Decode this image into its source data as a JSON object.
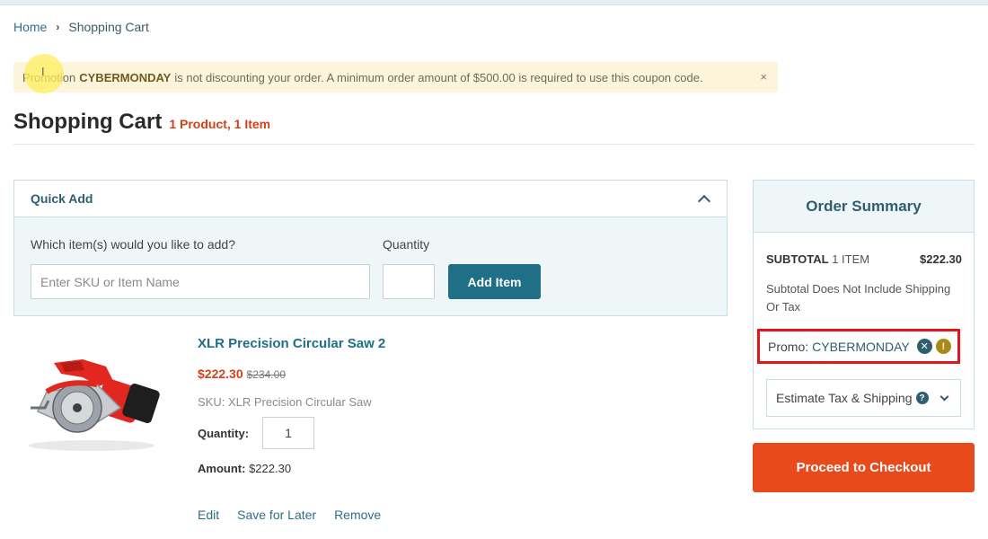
{
  "breadcrumb": {
    "home": "Home",
    "separator": "›",
    "current": "Shopping Cart"
  },
  "alert": {
    "prefix": "Promotion",
    "code": "CYBERMONDAY",
    "message": "is not discounting your order. A minimum order amount of $500.00 is required to use this coupon code.",
    "close": "×",
    "cursor": "I"
  },
  "page": {
    "title": "Shopping Cart",
    "count": "1 Product, 1 Item"
  },
  "quick_add": {
    "title": "Quick Add",
    "item_label": "Which item(s) would you like to add?",
    "quantity_label": "Quantity",
    "sku_placeholder": "Enter SKU or Item Name",
    "quantity_value": "",
    "add_button": "Add Item"
  },
  "product": {
    "name": "XLR Precision Circular Saw 2",
    "price": "$222.30",
    "was_price": "$234.00",
    "sku": "SKU: XLR Precision Circular Saw",
    "quantity_label": "Quantity:",
    "quantity": "1",
    "amount_label": "Amount:",
    "amount": "$222.30",
    "links": {
      "edit": "Edit",
      "save": "Save for Later",
      "remove": "Remove"
    },
    "image": "circular-saw"
  },
  "summary": {
    "title": "Order Summary",
    "subtotal_label": "SUBTOTAL",
    "subtotal_items": "1 ITEM",
    "subtotal_value": "$222.30",
    "note": "Subtotal Does Not Include Shipping Or Tax",
    "promo_label": "Promo:",
    "promo_code": "CYBERMONDAY",
    "remove_icon": "✕",
    "warning_icon": "!",
    "estimate": "Estimate Tax & Shipping",
    "help_icon": "?",
    "checkout": "Proceed to Checkout"
  },
  "colors": {
    "accent": "#1f6f86",
    "price": "#d2421a",
    "checkout": "#e84a1b",
    "alert_bg": "#fcf5dc",
    "promo_highlight": "#e8141c"
  }
}
